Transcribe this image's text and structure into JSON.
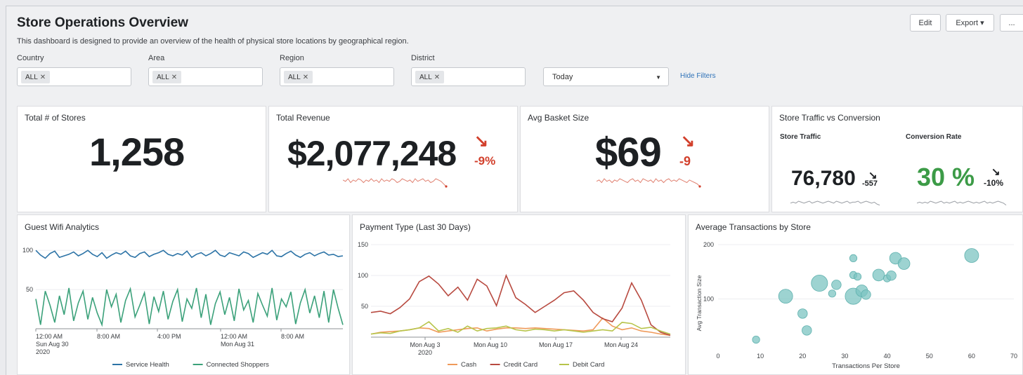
{
  "header": {
    "title": "Store Operations Overview",
    "description": "This dashboard is designed to provide an overview of the health of physical store locations by geographical region.",
    "edit_label": "Edit",
    "export_label": "Export ▾",
    "more_label": "..."
  },
  "filters": {
    "country": {
      "label": "Country",
      "chip": "ALL"
    },
    "area": {
      "label": "Area",
      "chip": "ALL"
    },
    "region": {
      "label": "Region",
      "chip": "ALL"
    },
    "district": {
      "label": "District",
      "chip": "ALL"
    },
    "time": {
      "value": "Today"
    },
    "hide_label": "Hide Filters",
    "remove_glyph": "✕"
  },
  "kpis": {
    "stores": {
      "title": "Total # of Stores",
      "value": "1,258"
    },
    "revenue": {
      "title": "Total Revenue",
      "value": "$2,077,248",
      "delta": "-9%",
      "arrow": "↘"
    },
    "basket": {
      "title": "Avg Basket Size",
      "value": "$69",
      "delta": "-9",
      "arrow": "↘"
    },
    "traffic_conv": {
      "title": "Store Traffic vs Conversion",
      "traffic_label": "Store Traffic",
      "traffic_value": "76,780",
      "traffic_delta": "-557",
      "conversion_label": "Conversion Rate",
      "conversion_value": "30 %",
      "conversion_delta": "-10%",
      "arrow": "↘"
    }
  },
  "colors": {
    "red": "#d2402c",
    "green": "#3c9b47",
    "service_health": "#2c73a6",
    "connected_shoppers": "#3ba17a",
    "cash": "#ef9a5a",
    "credit_card": "#b84a40",
    "debit_card": "#b7c44a",
    "bubble": "#7cc4c2"
  },
  "chart_data": [
    {
      "id": "wifi",
      "type": "line",
      "title": "Guest Wifi Analytics",
      "ylim": [
        0,
        110
      ],
      "yticks": [
        "100",
        "50"
      ],
      "xticks": [
        {
          "l1": "12:00 AM",
          "l2": "Sun Aug 30",
          "l3": "2020"
        },
        {
          "l1": "8:00 AM",
          "l2": "",
          "l3": ""
        },
        {
          "l1": "4:00 PM",
          "l2": "",
          "l3": ""
        },
        {
          "l1": "12:00 AM",
          "l2": "Mon Aug 31",
          "l3": ""
        },
        {
          "l1": "8:00 AM",
          "l2": "",
          "l3": ""
        }
      ],
      "series": [
        {
          "name": "Service Health",
          "color": "#2c73a6",
          "values": [
            100,
            94,
            90,
            96,
            99,
            91,
            93,
            95,
            98,
            93,
            96,
            100,
            95,
            92,
            97,
            90,
            94,
            97,
            95,
            99,
            93,
            91,
            96,
            98,
            92,
            95,
            97,
            100,
            95,
            93,
            96,
            94,
            99,
            91,
            95,
            97,
            93,
            96,
            100,
            94,
            92,
            97,
            95,
            93,
            98,
            96,
            91,
            94,
            97,
            95,
            100,
            93,
            92,
            96,
            99,
            94,
            91,
            95,
            97,
            93,
            96,
            98,
            94,
            95,
            92,
            93
          ]
        },
        {
          "name": "Connected Shoppers",
          "color": "#3ba17a",
          "values": [
            38,
            5,
            48,
            30,
            8,
            42,
            18,
            52,
            10,
            33,
            48,
            12,
            40,
            20,
            5,
            50,
            28,
            44,
            8,
            36,
            51,
            15,
            30,
            46,
            6,
            41,
            22,
            48,
            12,
            35,
            50,
            9,
            38,
            26,
            52,
            14,
            44,
            5,
            32,
            47,
            18,
            40,
            10,
            51,
            24,
            36,
            8,
            45,
            30,
            16,
            52,
            11,
            38,
            28,
            47,
            6,
            33,
            50,
            20,
            42,
            14,
            48,
            8,
            50,
            26,
            5
          ]
        }
      ]
    },
    {
      "id": "payment",
      "type": "line",
      "title": "Payment Type (Last 30 Days)",
      "ylim": [
        0,
        150
      ],
      "yticks": [
        "150",
        "100",
        "50"
      ],
      "xticks": [
        {
          "l1": "Mon Aug 3",
          "l2": "2020"
        },
        {
          "l1": "Mon Aug 10",
          "l2": ""
        },
        {
          "l1": "Mon Aug 17",
          "l2": ""
        },
        {
          "l1": "Mon Aug 24",
          "l2": ""
        }
      ],
      "series": [
        {
          "name": "Cash",
          "color": "#ef9a5a",
          "values": [
            5,
            8,
            9,
            10,
            12,
            15,
            14,
            8,
            10,
            12,
            14,
            15,
            10,
            13,
            15,
            15,
            14,
            15,
            14,
            13,
            12,
            11,
            10,
            12,
            31,
            18,
            12,
            15,
            10,
            8,
            5,
            3
          ]
        },
        {
          "name": "Credit Card",
          "color": "#b84a40",
          "values": [
            40,
            42,
            38,
            48,
            62,
            90,
            99,
            86,
            67,
            81,
            60,
            94,
            83,
            51,
            100,
            64,
            53,
            40,
            50,
            60,
            72,
            75,
            60,
            40,
            30,
            25,
            47,
            88,
            60,
            20,
            8,
            3
          ]
        },
        {
          "name": "Debit Card",
          "color": "#b7c44a",
          "values": [
            5,
            7,
            6,
            10,
            12,
            15,
            25,
            10,
            14,
            8,
            18,
            10,
            14,
            15,
            18,
            12,
            10,
            13,
            12,
            10,
            12,
            10,
            8,
            10,
            12,
            10,
            24,
            22,
            14,
            16,
            10,
            5
          ]
        }
      ]
    },
    {
      "id": "transactions",
      "type": "scatter",
      "title": "Average Transactions by Store",
      "xlabel": "Transactions Per Store",
      "ylabel": "Avg Transaction Size",
      "xlim": [
        0,
        70
      ],
      "ylim": [
        0,
        200
      ],
      "xticks": [
        "0",
        "10",
        "20",
        "30",
        "40",
        "50",
        "60",
        "70"
      ],
      "yticks": [
        "200",
        "100"
      ],
      "points": [
        {
          "x": 9,
          "y": 25,
          "r": 2
        },
        {
          "x": 16,
          "y": 105,
          "r": 5
        },
        {
          "x": 20,
          "y": 73,
          "r": 3
        },
        {
          "x": 21,
          "y": 42,
          "r": 3
        },
        {
          "x": 24,
          "y": 129,
          "r": 6
        },
        {
          "x": 27,
          "y": 110,
          "r": 2
        },
        {
          "x": 28,
          "y": 126,
          "r": 3
        },
        {
          "x": 32,
          "y": 105,
          "r": 6
        },
        {
          "x": 32,
          "y": 144,
          "r": 2
        },
        {
          "x": 32,
          "y": 175,
          "r": 2
        },
        {
          "x": 33,
          "y": 141,
          "r": 2
        },
        {
          "x": 34,
          "y": 115,
          "r": 4
        },
        {
          "x": 35,
          "y": 108,
          "r": 3
        },
        {
          "x": 38,
          "y": 144,
          "r": 4
        },
        {
          "x": 40,
          "y": 138,
          "r": 2
        },
        {
          "x": 41,
          "y": 143,
          "r": 3
        },
        {
          "x": 42,
          "y": 175,
          "r": 4
        },
        {
          "x": 44,
          "y": 165,
          "r": 4
        },
        {
          "x": 60,
          "y": 180,
          "r": 5
        }
      ]
    }
  ],
  "sparklines": {
    "revenue": [
      5,
      4,
      6,
      3,
      5,
      4,
      6,
      5,
      3,
      5,
      4,
      6,
      4,
      5,
      3,
      6,
      4,
      5,
      4,
      6,
      5,
      3,
      4,
      6,
      5,
      4,
      5,
      3,
      6,
      4,
      5,
      6,
      4,
      5,
      3,
      4,
      6,
      5,
      4,
      2,
      0
    ],
    "basket": [
      4,
      5,
      3,
      6,
      4,
      5,
      3,
      5,
      4,
      6,
      5,
      4,
      3,
      5,
      6,
      4,
      5,
      3,
      6,
      5,
      4,
      5,
      3,
      6,
      4,
      5,
      3,
      5,
      6,
      4,
      5,
      4,
      6,
      5,
      4,
      3,
      5,
      4,
      3,
      2,
      0
    ],
    "traffic": [
      3,
      4,
      3,
      5,
      4,
      3,
      4,
      5,
      3,
      4,
      5,
      4,
      3,
      4,
      5,
      4,
      3,
      5,
      4,
      3,
      4,
      5,
      3,
      4,
      4,
      5,
      3,
      4,
      5,
      4,
      3,
      4,
      2,
      1
    ],
    "conversion": [
      3,
      4,
      3,
      4,
      3,
      5,
      4,
      3,
      4,
      5,
      3,
      4,
      3,
      4,
      5,
      3,
      4,
      3,
      4,
      5,
      4,
      3,
      4,
      3,
      4,
      5,
      3,
      4,
      3,
      4,
      5,
      4,
      3,
      1
    ]
  }
}
